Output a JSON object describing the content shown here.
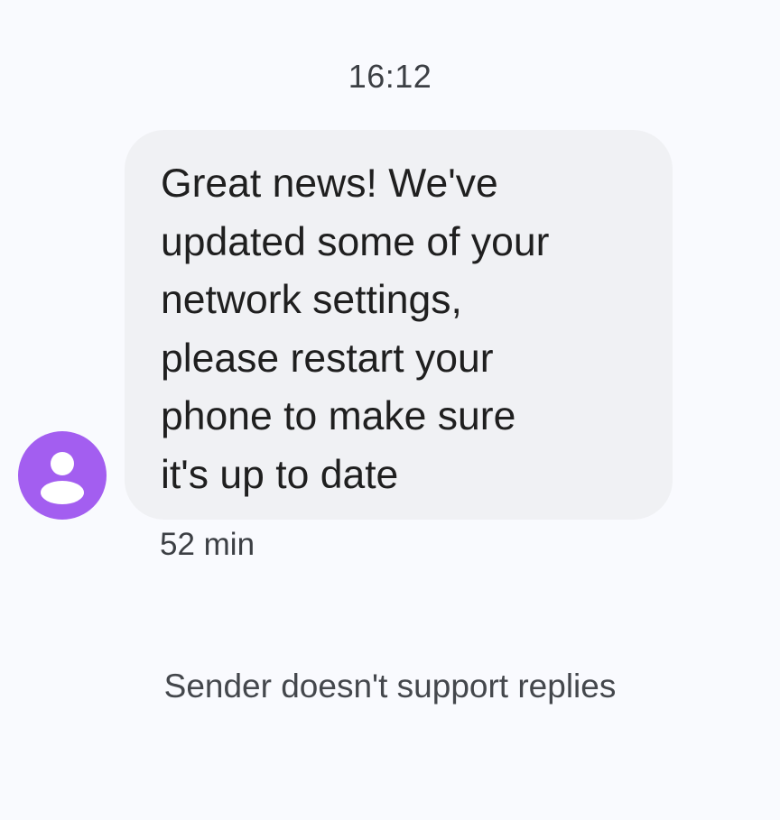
{
  "conversation": {
    "timestamp": "16:12",
    "message": {
      "lines": [
        "Great news! We've",
        "updated some of your",
        "network settings,",
        "please restart your",
        "phone to make sure",
        "it's up to date"
      ],
      "age": "52 min"
    },
    "sender": {
      "avatar_icon": "person-icon",
      "avatar_color": "#a35ef0"
    },
    "footer_note": "Sender doesn't support replies"
  },
  "colors": {
    "background": "#f9fafe",
    "bubble": "#f0f1f4",
    "text": "#1f1f1f",
    "secondary_text": "#3c3f44"
  }
}
